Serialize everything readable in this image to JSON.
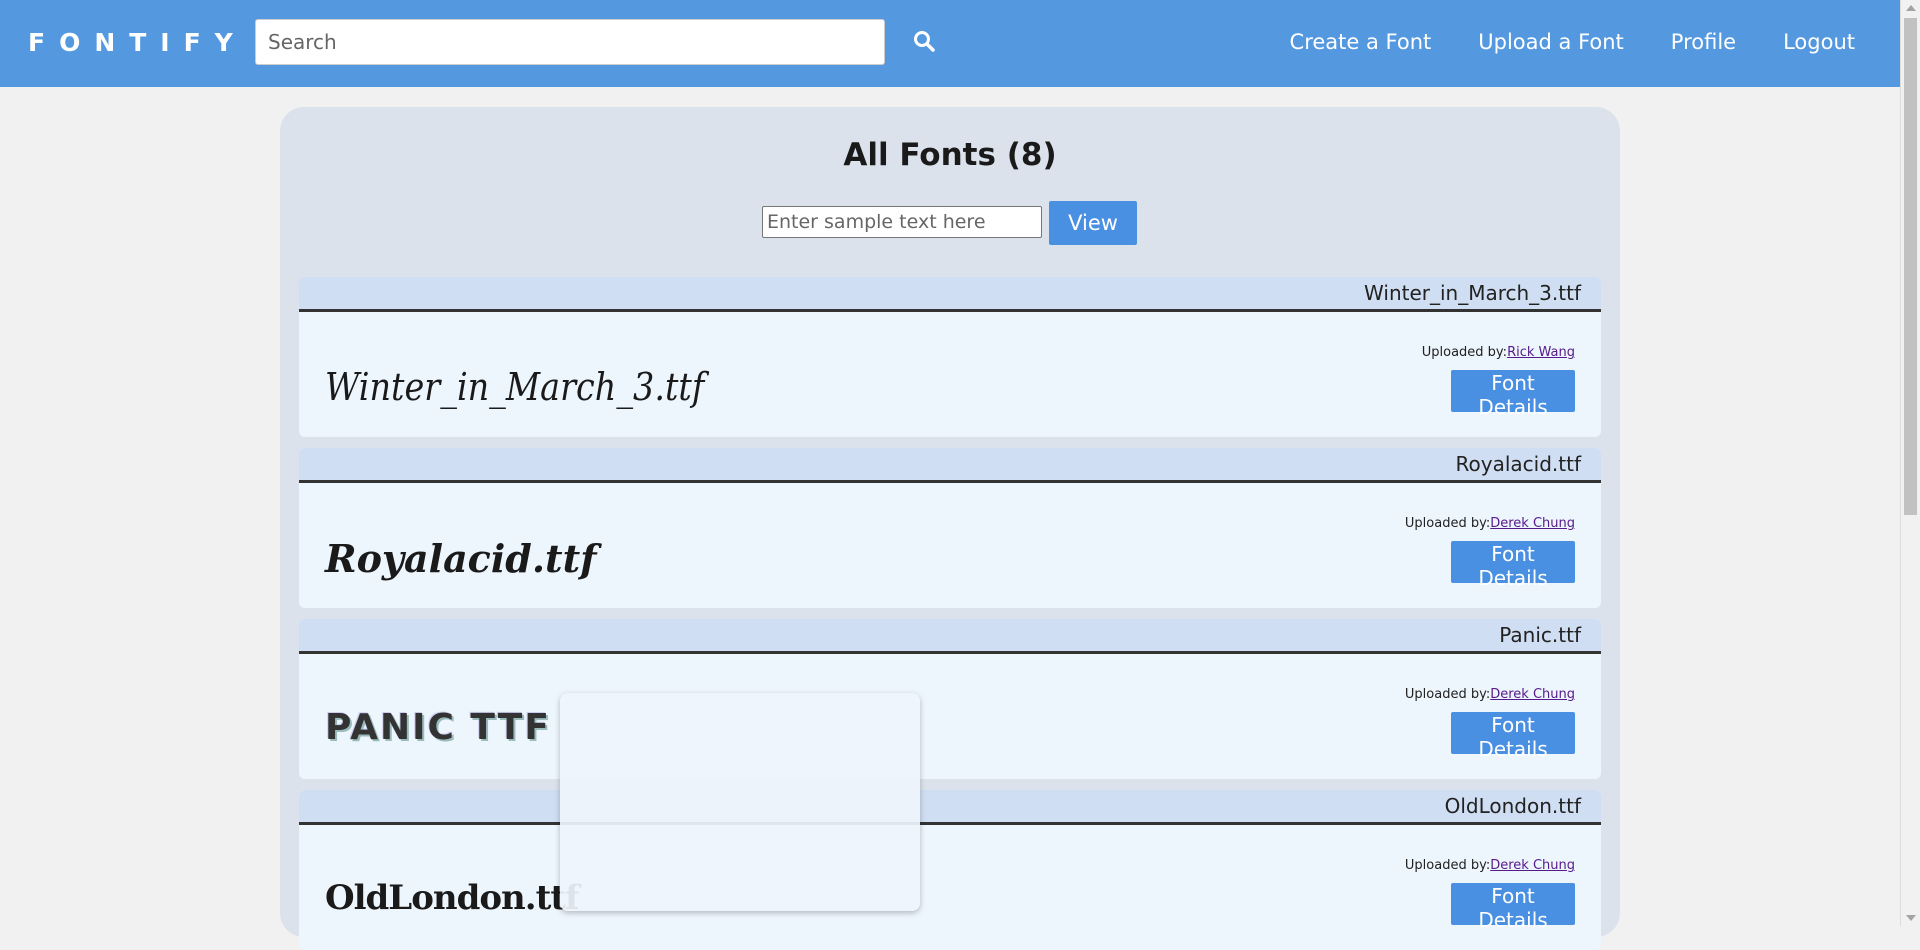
{
  "header": {
    "brand": "FONTIFY",
    "search_placeholder": "Search",
    "nav": [
      "Create a Font",
      "Upload a Font",
      "Profile",
      "Logout"
    ]
  },
  "main": {
    "title": "All Fonts (8)",
    "sample_placeholder": "Enter sample text here",
    "view_label": "View"
  },
  "fonts": [
    {
      "filename": "Winter_in_March_3.ttf",
      "preview": "Winter_in_March_3.ttf",
      "uploaded_label": "Uploaded by:",
      "uploader": "Rick Wang",
      "button": "Font Details"
    },
    {
      "filename": "Royalacid.ttf",
      "preview": "Royalacid.ttf",
      "uploaded_label": "Uploaded by:",
      "uploader": "Derek Chung",
      "button": "Font Details"
    },
    {
      "filename": "Panic.ttf",
      "preview": "PANIC TTF",
      "uploaded_label": "Uploaded by:",
      "uploader": "Derek Chung",
      "button": "Font Details"
    },
    {
      "filename": "OldLondon.ttf",
      "preview": "OldLondon.ttf",
      "uploaded_label": "Uploaded by:",
      "uploader": "Derek Chung",
      "button": "Font Details"
    }
  ],
  "colors": {
    "nav": "#5499e0",
    "button": "#4a90e2",
    "panel": "#dce2ec",
    "card": "#edf5fd",
    "card_header": "#d0def3",
    "link": "#551a8b"
  },
  "icons": {
    "search": "search-icon"
  }
}
